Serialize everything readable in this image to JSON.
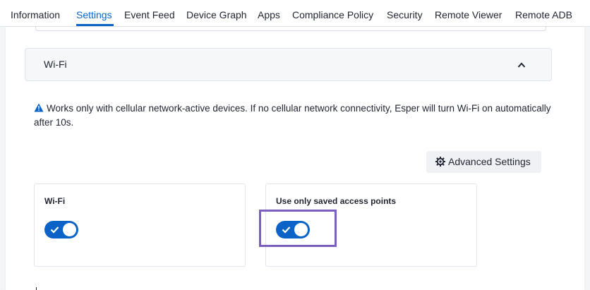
{
  "tabs": [
    {
      "label": "Information",
      "active": false
    },
    {
      "label": "Settings",
      "active": true
    },
    {
      "label": "Event Feed",
      "active": false
    },
    {
      "label": "Device Graph",
      "active": false
    },
    {
      "label": "Apps",
      "active": false
    },
    {
      "label": "Compliance Policy",
      "active": false
    },
    {
      "label": "Security",
      "active": false
    },
    {
      "label": "Remote Viewer",
      "active": false
    },
    {
      "label": "Remote ADB",
      "active": false
    }
  ],
  "section": {
    "title": "Wi-Fi",
    "expanded": true,
    "chevron_icon": "chevron-up-icon"
  },
  "warning": {
    "icon": "warning-triangle-icon",
    "text": "Works only with cellular network-active devices. If no cellular network connectivity, Esper will turn Wi-Fi on automatically after 10s."
  },
  "advanced_button": {
    "icon": "gear-icon",
    "label": "Advanced Settings"
  },
  "cards": [
    {
      "title": "Wi-Fi",
      "enabled": true
    },
    {
      "title": "Use only saved access points",
      "enabled": true
    }
  ],
  "colors": {
    "accent": "#0b63c8",
    "highlight": "#7a5fbf"
  }
}
